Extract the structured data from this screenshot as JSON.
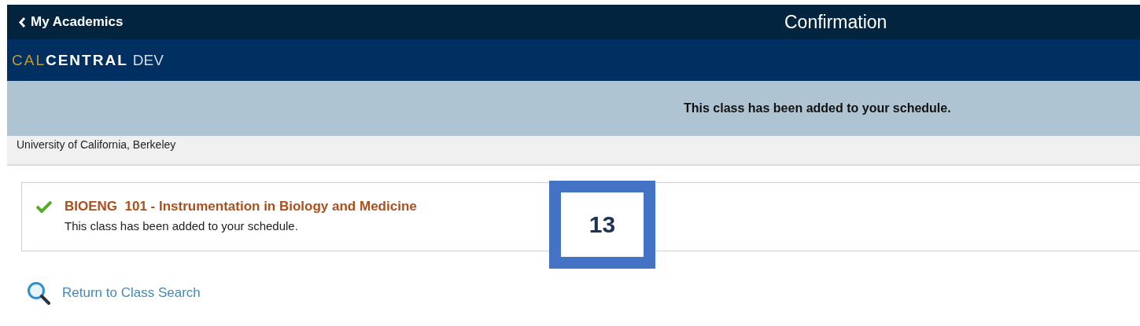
{
  "header": {
    "back_link": "My Academics",
    "title": "Confirmation"
  },
  "brand": {
    "cal": "CAL",
    "central": "CENTRAL",
    "env": "DEV"
  },
  "banner": {
    "message": "This class has been added to your schedule."
  },
  "institution": "University of California, Berkeley",
  "results": [
    {
      "kind": "success",
      "course": "BIOENG  101 - Instrumentation in Biology and Medicine",
      "message": "This class has been added to your schedule."
    }
  ],
  "return_link": "Return to Class Search",
  "annotation": {
    "label": "13"
  }
}
